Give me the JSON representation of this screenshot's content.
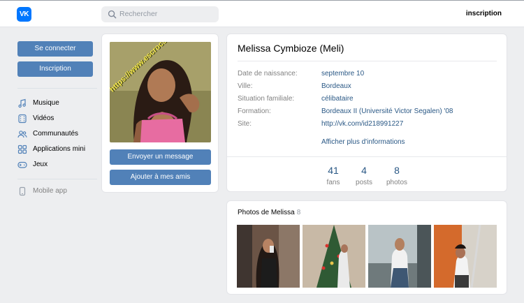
{
  "header": {
    "logo_text": "VK",
    "search_placeholder": "Rechercher",
    "signup_link": "inscription"
  },
  "sidebar": {
    "login_button": "Se connecter",
    "signup_button": "Inscription",
    "items": [
      {
        "label": "Musique",
        "icon": "music-note-icon"
      },
      {
        "label": "Vidéos",
        "icon": "film-icon"
      },
      {
        "label": "Communautés",
        "icon": "people-icon"
      },
      {
        "label": "Applications mini",
        "icon": "grid-icon"
      },
      {
        "label": "Jeux",
        "icon": "gamepad-icon"
      }
    ],
    "mobile_app": "Mobile app"
  },
  "profile_card": {
    "watermark": "https://www.escrocs-du-web.fr",
    "message_button": "Envoyer un message",
    "add_friend_button": "Ajouter à mes amis"
  },
  "info": {
    "name": "Melissa Cymbioze (Meli)",
    "rows": [
      {
        "label": "Date de naissance:",
        "value": "septembre 10"
      },
      {
        "label": "Ville:",
        "value": "Bordeaux"
      },
      {
        "label": "Situation familiale:",
        "value": "célibataire"
      },
      {
        "label": "Formation:",
        "value": "Bordeaux II (Université Victor Segalen) '08"
      },
      {
        "label": "Site:",
        "value": "http://vk.com/id218991227"
      }
    ],
    "more_link": "Afficher plus d'informations",
    "stats": [
      {
        "num": "41",
        "label": "fans"
      },
      {
        "num": "4",
        "label": "posts"
      },
      {
        "num": "8",
        "label": "photos"
      }
    ]
  },
  "photos": {
    "title": "Photos de Melissa",
    "count": "8"
  },
  "colors": {
    "accent": "#5181b8",
    "link": "#2a5885",
    "logo": "#0077ff",
    "page_bg": "#edeef0"
  }
}
